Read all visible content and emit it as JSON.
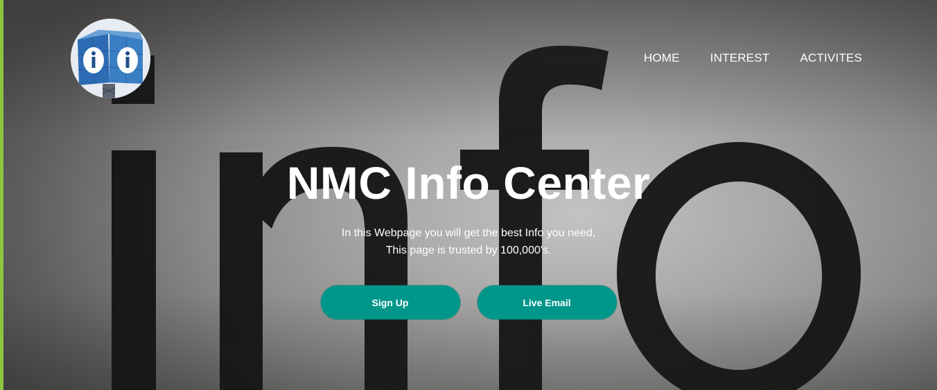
{
  "logo": {
    "icon": "info-building-icon"
  },
  "nav": {
    "items": [
      {
        "label": "HOME"
      },
      {
        "label": "INTEREST"
      },
      {
        "label": "ACTIVITES"
      }
    ]
  },
  "hero": {
    "title": "NMC Info Center",
    "subtitle_line1": "In this Webpage you will get the best Info you need,",
    "subtitle_line2": "This page is trusted by 100,000's."
  },
  "buttons": {
    "signup_label": "Sign Up",
    "live_email_label": "Live Email"
  },
  "colors": {
    "accent_strip": "#8cc63e",
    "button": "#00968a",
    "text": "#ffffff"
  }
}
